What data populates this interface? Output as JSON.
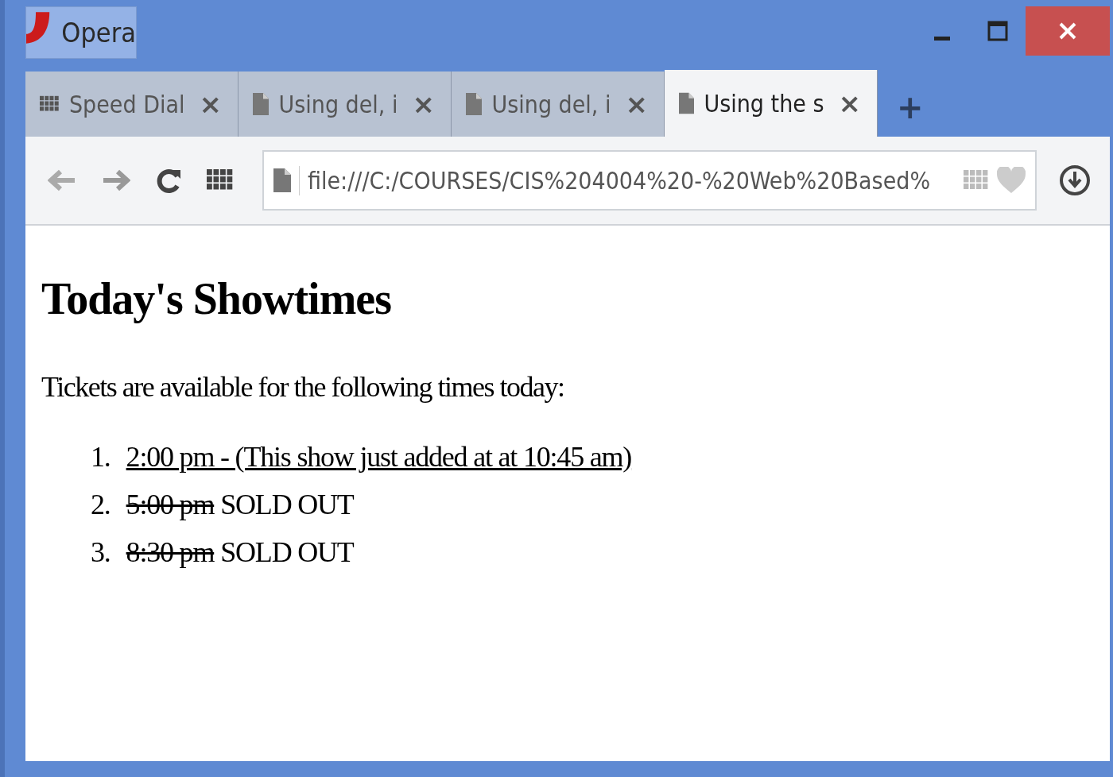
{
  "window": {
    "app_button": "Opera"
  },
  "tabs": [
    {
      "kind": "speed-dial",
      "title": "Speed Dial",
      "close": "×",
      "selected": false
    },
    {
      "kind": "page",
      "title": "Using del, i",
      "close": "×",
      "selected": false
    },
    {
      "kind": "page",
      "title": "Using del, i",
      "close": "×",
      "selected": false
    },
    {
      "kind": "page",
      "title": "Using the s",
      "close": "×",
      "selected": true
    }
  ],
  "new_tab": "+",
  "address_bar": {
    "value": "file:///C:/COURSES/CIS%204004%20-%20Web%20Based%"
  },
  "page": {
    "heading": "Today's Showtimes",
    "intro": "Tickets are available for the following times today:",
    "showtimes": [
      {
        "number": "1.",
        "kind": "added",
        "time": "2:00 pm - (This show just added at at 10:45 am)"
      },
      {
        "number": "2.",
        "kind": "sold-out",
        "time": "5:00 pm",
        "note": "SOLD OUT"
      },
      {
        "number": "3.",
        "kind": "sold-out",
        "time": "8:30 pm",
        "note": "SOLD OUT"
      }
    ]
  }
}
